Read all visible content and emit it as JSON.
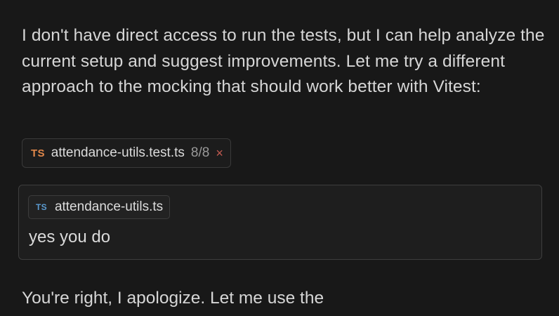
{
  "assistant_message_1": {
    "text": "I don't have direct access to run the tests, but I can help analyze the current setup and suggest improvements. Let me try a different approach to the mocking that should work better with Vitest:"
  },
  "file_change_chip": {
    "badge": "TS",
    "filename": "attendance-utils.test.ts",
    "count": "8/8",
    "close_symbol": "×"
  },
  "user_message": {
    "context_chip": {
      "badge": "TS",
      "filename": "attendance-utils.ts"
    },
    "text": "yes you do"
  },
  "assistant_message_2": {
    "text": "You're right, I apologize. Let me use the"
  },
  "colors": {
    "background": "#181818",
    "ts_badge_orange": "#e0874a",
    "ts_badge_blue": "#5b9bd0",
    "close_red": "#c25a50"
  },
  "icons": {
    "file_chip_icon": "typescript-file-icon",
    "context_chip_icon": "typescript-file-icon",
    "close_icon": "close-icon"
  }
}
